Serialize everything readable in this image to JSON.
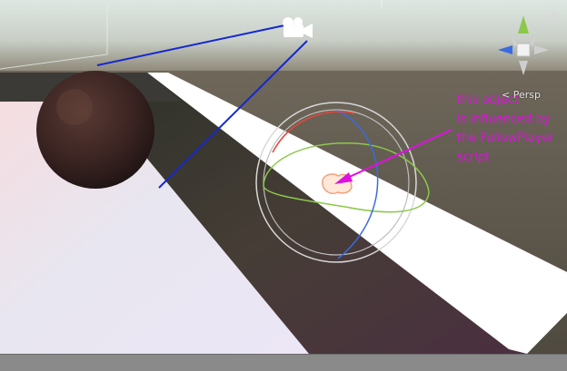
{
  "scene": {
    "projection_label": "< Persp",
    "annotation_text": "this object\nis influenced by\nthe FollowPlayer\nscript",
    "camera_icon": "camera-icon",
    "gizmo_icon": "scene-orientation-gizmo-icon",
    "colors": {
      "annotation": "#e010e0",
      "line": "#1428d0",
      "sky": "#cfd6d0",
      "ground": "#5c5447",
      "ramp": "#ffffff",
      "axis_x": "#e8453c",
      "axis_y": "#8cc84b",
      "axis_z": "#3a6be0"
    }
  }
}
